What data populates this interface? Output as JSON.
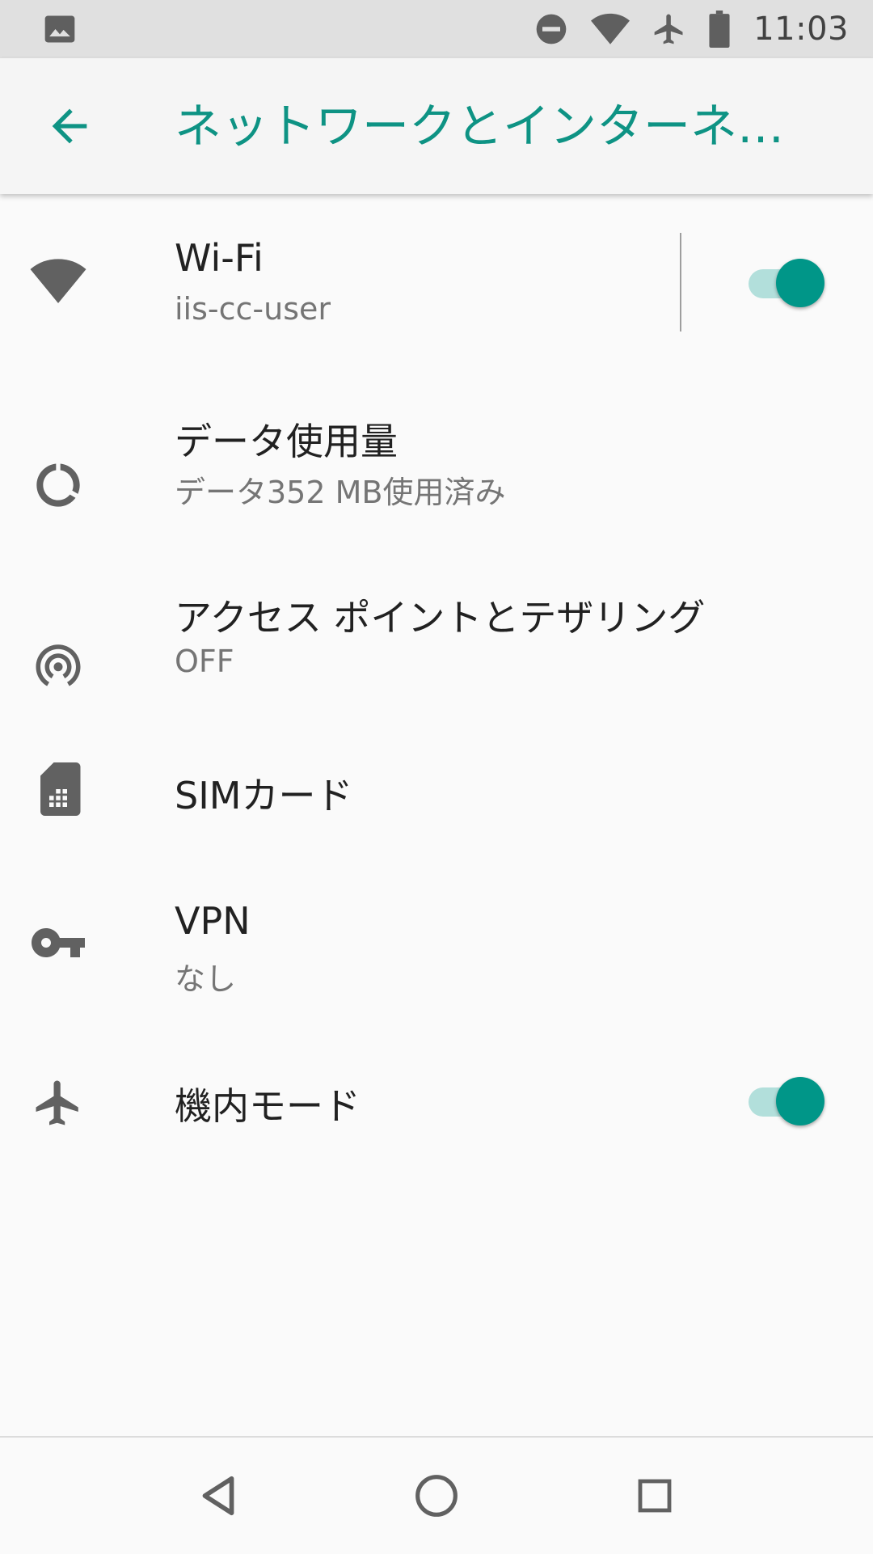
{
  "status_bar": {
    "time": "11:03",
    "icons": [
      "gallery-notification-icon",
      "do-not-disturb-icon",
      "wifi-icon",
      "airplane-icon",
      "battery-icon"
    ]
  },
  "app_bar": {
    "title": "ネットワークとインターネ…",
    "back_icon": "arrow-back-icon",
    "accent_color": "#0e9384"
  },
  "settings": {
    "wifi": {
      "label": "Wi-Fi",
      "summary": "iis-cc-user",
      "icon": "wifi-icon",
      "enabled": true
    },
    "data_usage": {
      "label": "データ使用量",
      "summary": "データ352 MB使用済み",
      "icon": "data-usage-icon"
    },
    "hotspot": {
      "label": "アクセス ポイントとテザリング",
      "summary": "OFF",
      "icon": "hotspot-icon"
    },
    "sim": {
      "label": "SIMカード",
      "icon": "sim-card-icon"
    },
    "vpn": {
      "label": "VPN",
      "summary": "なし",
      "icon": "vpn-key-icon"
    },
    "airplane": {
      "label": "機内モード",
      "icon": "airplane-icon",
      "enabled": true
    }
  },
  "toggle_colors": {
    "thumb": "#009688",
    "track": "#b2dfdb"
  },
  "nav_bar": {
    "icons": [
      "back-triangle-icon",
      "home-circle-icon",
      "recents-square-icon"
    ]
  }
}
